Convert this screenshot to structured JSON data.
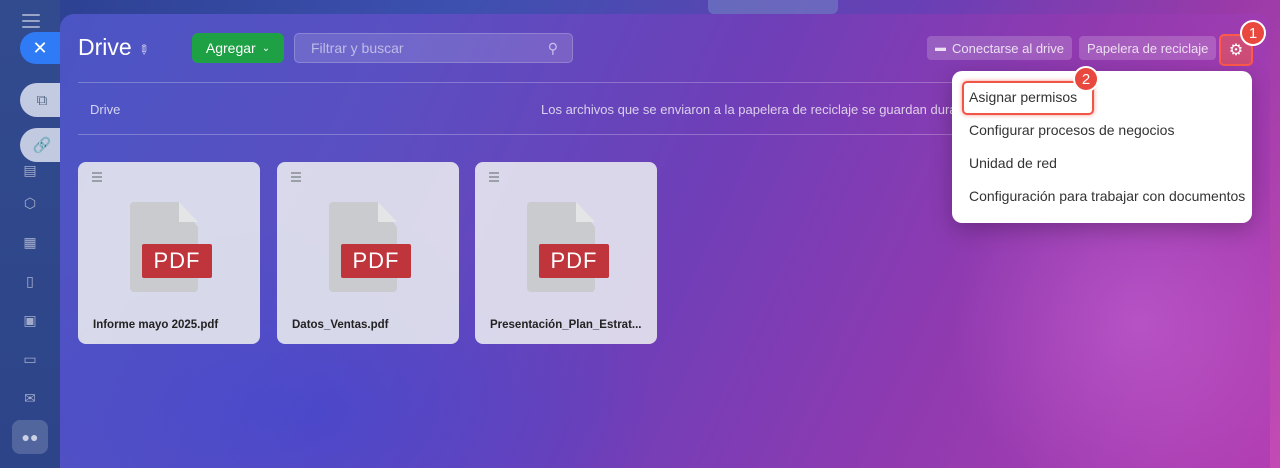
{
  "panel": {
    "title": "Drive",
    "add_button_label": "Agregar",
    "search_placeholder": "Filtrar y buscar",
    "connect_button_label": "Conectarse al drive",
    "trash_button_label": "Papelera de reciclaje",
    "breadcrumb": "Drive",
    "trash_notice": "Los archivos que se enviaron a la papelera de reciclaje se guardan durant"
  },
  "files": [
    {
      "name": "Informe mayo 2025.pdf",
      "type_label": "PDF"
    },
    {
      "name": "Datos_Ventas.pdf",
      "type_label": "PDF"
    },
    {
      "name": "Presentación_Plan_Estrat...",
      "type_label": "PDF"
    }
  ],
  "settings_menu": {
    "items": [
      {
        "label": "Asignar permisos"
      },
      {
        "label": "Configurar procesos de negocios"
      },
      {
        "label": "Unidad de red"
      },
      {
        "label": "Configuración para trabajar con documentos"
      }
    ]
  },
  "annotations": {
    "step1": "1",
    "step2": "2",
    "highlight_color": "#f05545"
  },
  "colors": {
    "add_button": "#1ea045",
    "close_button": "#2f7bf5",
    "pdf_badge": "#c0343b"
  },
  "icons": {
    "close": "close-icon",
    "pin": "pin-icon",
    "search": "search-icon",
    "gear": "gear-icon",
    "drive": "drive-icon"
  }
}
